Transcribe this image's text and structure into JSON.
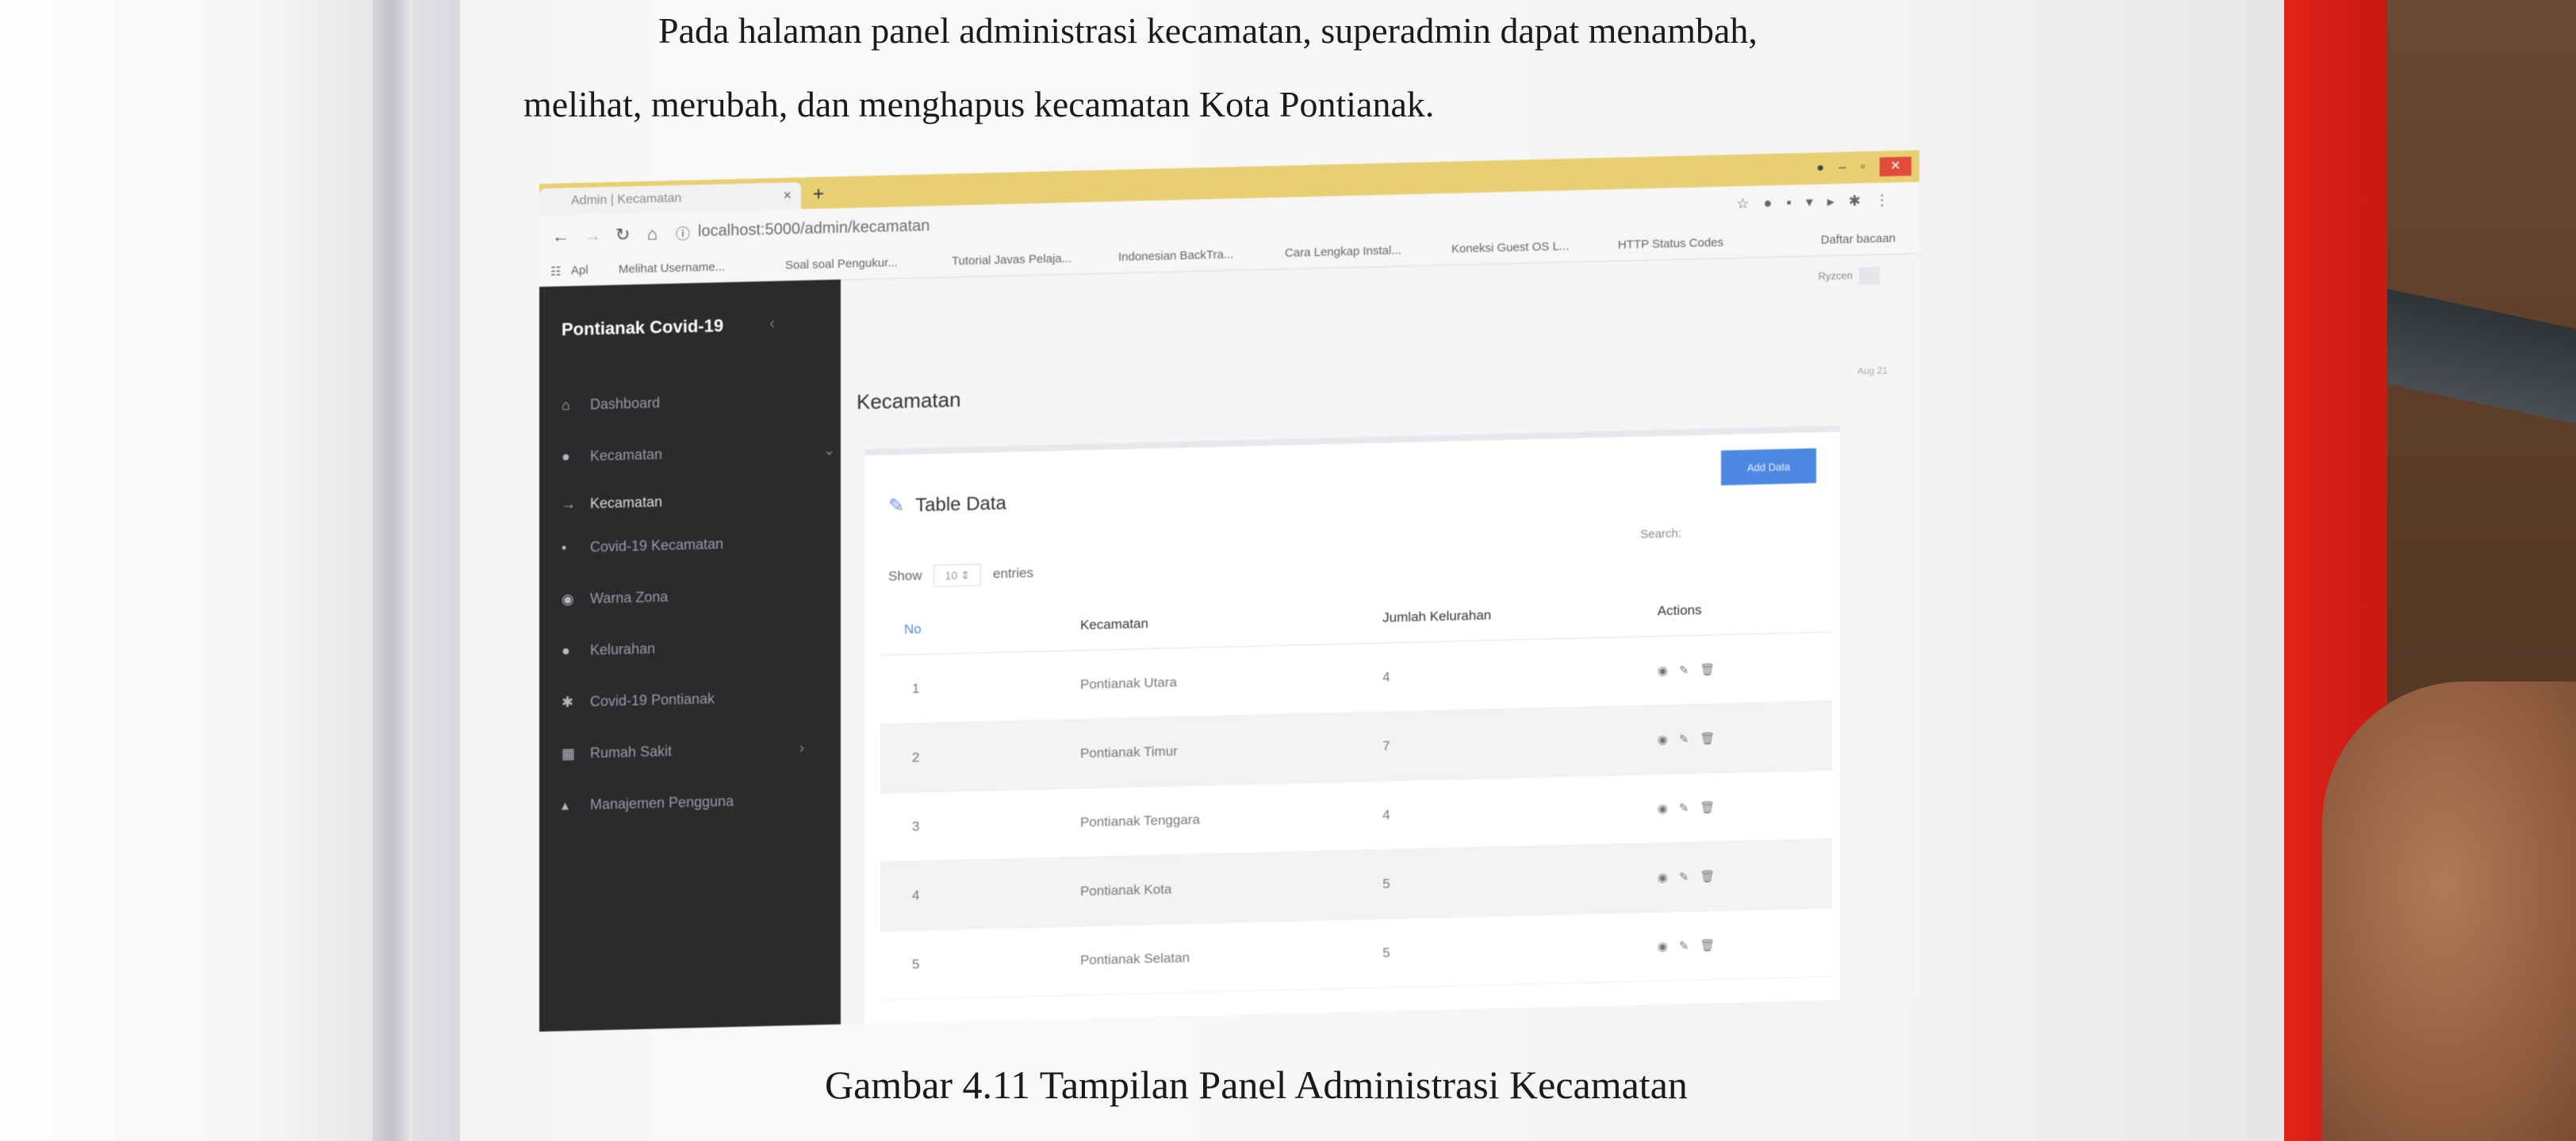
{
  "book": {
    "paragraph_line1": "Pada halaman panel administrasi kecamatan, superadmin dapat menambah,",
    "paragraph_line2": "melihat, merubah, dan menghapus kecamatan Kota Pontianak.",
    "caption": "Gambar 4.11 Tampilan Panel Administrasi Kecamatan"
  },
  "browser": {
    "tab_title": "Admin | Kecamatan",
    "url": "localhost:5000/admin/kecamatan",
    "bookmarks": [
      "Apl",
      "Melihat Username...",
      "Soal soal Pengukur...",
      "Tutorial Javas Pelaja...",
      "Indonesian BackTra...",
      "Cara Lengkap Instal...",
      "Koneksi Guest OS L...",
      "HTTP Status Codes"
    ],
    "other_bookmarks": "Daftar bacaan"
  },
  "sidebar": {
    "brand": "Pontianak Covid-19",
    "items": [
      {
        "label": "Dashboard",
        "icon": "home-icon"
      },
      {
        "label": "Kecamatan",
        "icon": "location-icon"
      },
      {
        "label": "Kecamatan",
        "icon": "arrow-right-icon"
      },
      {
        "label": "Covid-19 Kecamatan",
        "icon": "bullet-icon"
      },
      {
        "label": "Warna Zona",
        "icon": "circle-icon"
      },
      {
        "label": "Kelurahan",
        "icon": "location-icon"
      },
      {
        "label": "Covid-19 Pontianak",
        "icon": "virus-icon"
      },
      {
        "label": "Rumah Sakit",
        "icon": "building-icon"
      },
      {
        "label": "Manajemen Pengguna",
        "icon": "users-icon"
      }
    ]
  },
  "header": {
    "profile": "Ryzcen",
    "page_title": "Kecamatan",
    "breadcrumb": "Aug 21"
  },
  "card": {
    "title": "Table Data",
    "add_button": "Add Data",
    "show_label": "Show",
    "show_value": "10",
    "entries_label": "entries",
    "search_label": "Search:",
    "columns": [
      "No",
      "Kecamatan",
      "Jumlah Kelurahan",
      "Actions"
    ],
    "rows": [
      {
        "no": "1",
        "kecamatan": "Pontianak Utara",
        "jumlah": "4"
      },
      {
        "no": "2",
        "kecamatan": "Pontianak Timur",
        "jumlah": "7"
      },
      {
        "no": "3",
        "kecamatan": "Pontianak Tenggara",
        "jumlah": "4"
      },
      {
        "no": "4",
        "kecamatan": "Pontianak Kota",
        "jumlah": "5"
      },
      {
        "no": "5",
        "kecamatan": "Pontianak Selatan",
        "jumlah": "5"
      }
    ]
  },
  "colors": {
    "sidebar_bg": "#2b2b2e",
    "accent_blue": "#4f88e3",
    "tab_bar": "#e8cf73",
    "book_cover_red": "#d8221a"
  }
}
